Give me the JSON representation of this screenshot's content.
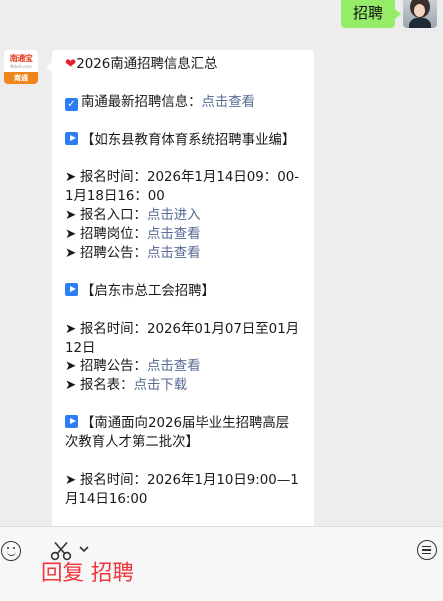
{
  "outgoing": {
    "text": "招聘"
  },
  "account": {
    "logo_text": "南通宝",
    "logo_url": "Ntbsh.com",
    "logo_city": "南通"
  },
  "message": {
    "title": "2026南通招聘信息汇总",
    "latest_label": "南通最新招聘信息：",
    "latest_link": "点击查看",
    "sections": [
      {
        "heading": "【如东县教育体育系统招聘事业编】",
        "items": [
          {
            "label": "报名时间：",
            "value": "2026年1月14日09：00-1月18日16：00",
            "link": ""
          },
          {
            "label": "报名入口：",
            "value": "",
            "link": "点击进入"
          },
          {
            "label": "招聘岗位：",
            "value": "",
            "link": "点击查看"
          },
          {
            "label": "招聘公告：",
            "value": "",
            "link": "点击查看"
          }
        ]
      },
      {
        "heading": "【启东市总工会招聘】",
        "items": [
          {
            "label": "报名时间：",
            "value": "2026年01月07日至01月12日",
            "link": ""
          },
          {
            "label": "招聘公告：",
            "value": "",
            "link": "点击查看"
          },
          {
            "label": "报名表：",
            "value": "",
            "link": "点击下载"
          }
        ]
      },
      {
        "heading": "【南通面向2026届毕业生招聘高层次教育人才第二批次】",
        "items": [
          {
            "label": "报名时间：",
            "value": "2026年1月10日9:00—1月14日16:00",
            "link": ""
          }
        ]
      }
    ]
  },
  "input_bar": {
    "reply_hint": "回复 招聘"
  },
  "icons": {
    "heart": "heart-icon",
    "check": "check-box-icon",
    "play": "play-button-icon",
    "arrow": "arrow-bullet-icon",
    "emoji": "emoji-icon",
    "scissors": "scissors-icon",
    "chevron": "chevron-down-icon",
    "menu": "menu-list-icon"
  },
  "colors": {
    "outgoing_bubble": "#95ec69",
    "link": "#576b95",
    "icon_blue": "#2d7ef5",
    "heart": "#e5202e",
    "reply_hint": "#f0353b"
  }
}
